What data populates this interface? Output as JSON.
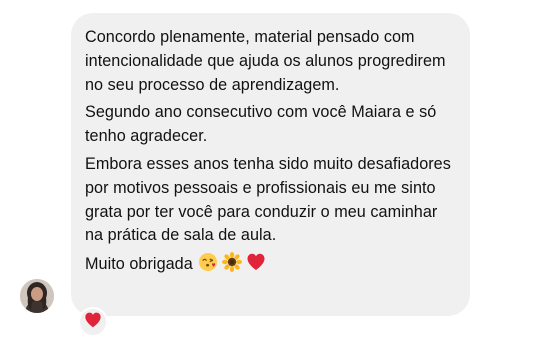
{
  "chat": {
    "message": {
      "paragraphs": [
        "Concordo plenamente, material pensado com intencionalidade que ajuda os alunos progredirem no seu processo de aprendizagem.",
        "Segundo ano consecutivo com você Maiara e só tenho agradecer.",
        "Embora esses anos tenha sido muito desafiadores por motivos pessoais e profissionais eu me sinto grata por ter você para conduzir o meu caminhar na prática de sala de aula."
      ],
      "closing": "Muito obrigada",
      "closing_emojis": [
        "face-blowing-kiss-icon",
        "sunflower-icon",
        "red-heart-icon"
      ]
    },
    "reaction": "red-heart-icon",
    "colors": {
      "bubble": "#f0f0f1",
      "text": "#111111",
      "heart": "#e0243a"
    }
  }
}
